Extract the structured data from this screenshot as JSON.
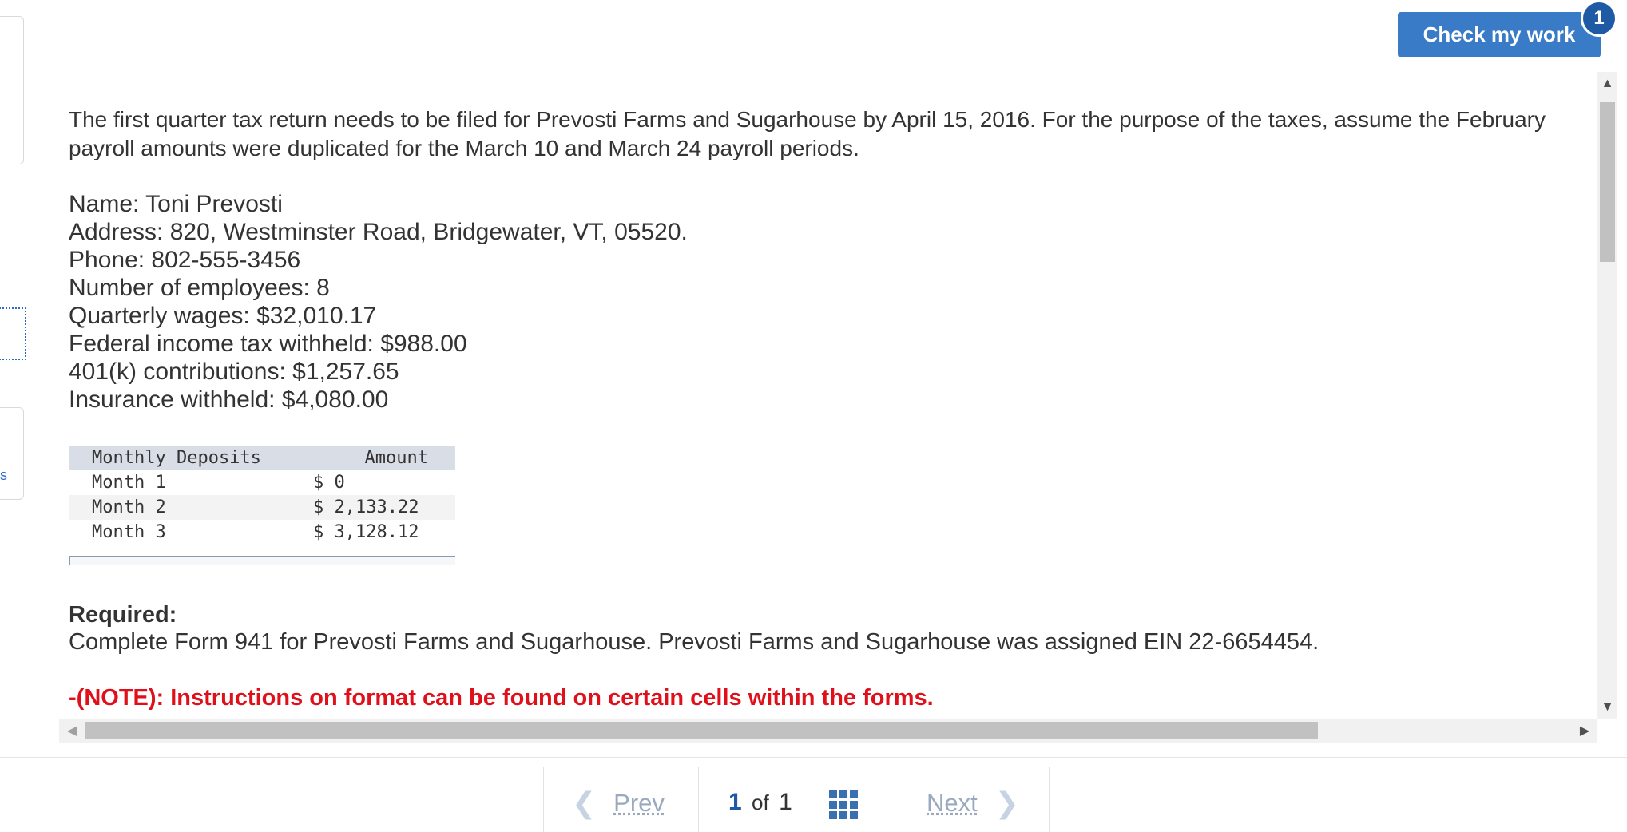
{
  "header": {
    "check_button": "Check my work",
    "badge_count": "1"
  },
  "left_edge": {
    "glyph": "s"
  },
  "intro": "The first quarter tax return needs to be filed for Prevosti Farms and Sugarhouse by April 15, 2016. For the purpose of the taxes, assume the February payroll amounts were duplicated for the March 10 and March 24 payroll periods.",
  "info": [
    "Name: Toni Prevosti",
    "Address: 820, Westminster Road, Bridgewater, VT, 05520.",
    "Phone: 802-555-3456",
    "Number of employees: 8",
    "Quarterly wages: $32,010.17",
    "Federal income tax withheld: $988.00",
    "401(k) contributions: $1,257.65",
    "Insurance withheld: $4,080.00"
  ],
  "deposits": {
    "headers": [
      "Monthly Deposits",
      "Amount"
    ],
    "rows": [
      [
        "Month 1",
        "$ 0"
      ],
      [
        "Month 2",
        "$ 2,133.22"
      ],
      [
        "Month 3",
        "$ 3,128.12"
      ]
    ]
  },
  "required": {
    "title": "Required:",
    "text": "Complete Form 941 for Prevosti Farms and Sugarhouse. Prevosti Farms and Sugarhouse was assigned EIN 22-6654454.",
    "note": "-(NOTE): Instructions on format can be found on certain cells within the forms."
  },
  "nav": {
    "prev": "Prev",
    "next": "Next",
    "current": "1",
    "of": "of",
    "total": "1",
    "prev_icon": "chevron-left-icon",
    "next_icon": "chevron-right-icon",
    "grid_icon": "grid-icon"
  },
  "colors": {
    "accent": "#3a7bc8",
    "badge": "#1f5aa5",
    "note": "#e0101a",
    "table_header": "#d9dde6"
  }
}
